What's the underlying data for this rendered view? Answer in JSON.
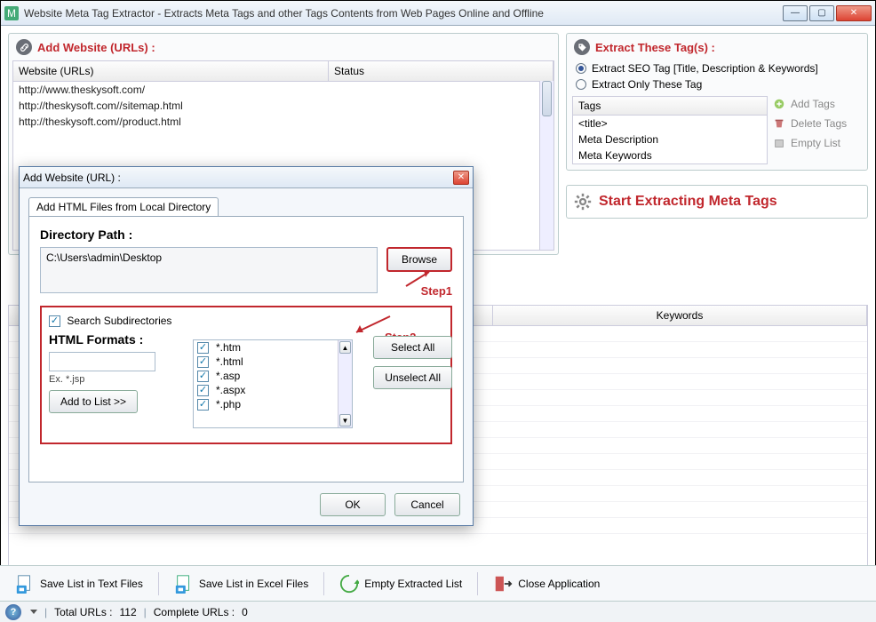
{
  "window": {
    "title": "Website Meta Tag Extractor - Extracts Meta Tags and other Tags Contents from Web Pages Online and Offline"
  },
  "left_panel": {
    "title": "Add Website (URLs) :",
    "col_url": "Website (URLs)",
    "col_status": "Status",
    "rows": [
      "http://www.theskysoft.com/",
      "http://theskysoft.com//sitemap.html",
      "http://theskysoft.com//product.html"
    ]
  },
  "right_panel": {
    "title": "Extract These Tag(s) :",
    "opt1": "Extract SEO Tag [Title, Description & Keywords]",
    "opt2": "Extract Only These Tag",
    "tags_header": "Tags",
    "tags": [
      "<title>",
      "Meta Description",
      "Meta Keywords"
    ],
    "btn_add": "Add Tags",
    "btn_del": "Delete Tags",
    "btn_empty": "Empty List"
  },
  "start": {
    "label": "Start Extracting Meta Tags"
  },
  "results": {
    "col_keywords": "Keywords"
  },
  "toolbar": {
    "save_txt": "Save List in Text Files",
    "save_xls": "Save List in Excel Files",
    "empty": "Empty Extracted List",
    "close": "Close Application"
  },
  "statusbar": {
    "total_label": "Total URLs :",
    "total_value": "112",
    "complete_label": "Complete URLs :",
    "complete_value": "0"
  },
  "modal": {
    "title": "Add Website (URL) :",
    "tab": "Add HTML Files from Local Directory",
    "dir_label": "Directory Path :",
    "dir_value": "C:\\Users\\admin\\Desktop",
    "browse": "Browse",
    "step1": "Step1",
    "step2": "Step2",
    "search_sub": "Search Subdirectories",
    "formats_label": "HTML Formats :",
    "ext_placeholder": "",
    "hint": "Ex. *.jsp",
    "add_to_list": "Add to List >>",
    "formats": [
      "*.htm",
      "*.html",
      "*.asp",
      "*.aspx",
      "*.php"
    ],
    "select_all": "Select All",
    "unselect_all": "Unselect All",
    "ok": "OK",
    "cancel": "Cancel"
  }
}
